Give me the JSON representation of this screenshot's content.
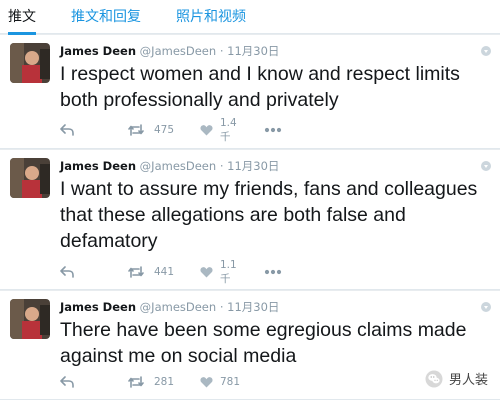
{
  "tabs": [
    {
      "label": "推文"
    },
    {
      "label": "推文和回复"
    },
    {
      "label": "照片和视频"
    }
  ],
  "tweets": [
    {
      "name": "James Deen",
      "handle": "@JamesDeen",
      "separator": "·",
      "date": "11月30日",
      "text": "I respect women and I know and respect limits both professionally and privately",
      "retweets": "475",
      "likes": "1.4千"
    },
    {
      "name": "James Deen",
      "handle": "@JamesDeen",
      "separator": "·",
      "date": "11月30日",
      "text": "I want to assure my friends, fans and colleagues that these allegations are both false and defamatory",
      "retweets": "441",
      "likes": "1.1千"
    },
    {
      "name": "James Deen",
      "handle": "@JamesDeen",
      "separator": "·",
      "date": "11月30日",
      "text": "There have been some egregious claims made against me on social media",
      "retweets": "281",
      "likes": "781"
    }
  ],
  "watermark": {
    "text": "男人装"
  },
  "icons": {
    "reply": "reply-icon",
    "retweet": "retweet-icon",
    "like": "heart-icon",
    "more": "more-icon",
    "caret": "chevron-down-icon"
  },
  "colors": {
    "accent": "#1b95e0",
    "muted": "#8899a6",
    "background": "#e8ecef"
  }
}
